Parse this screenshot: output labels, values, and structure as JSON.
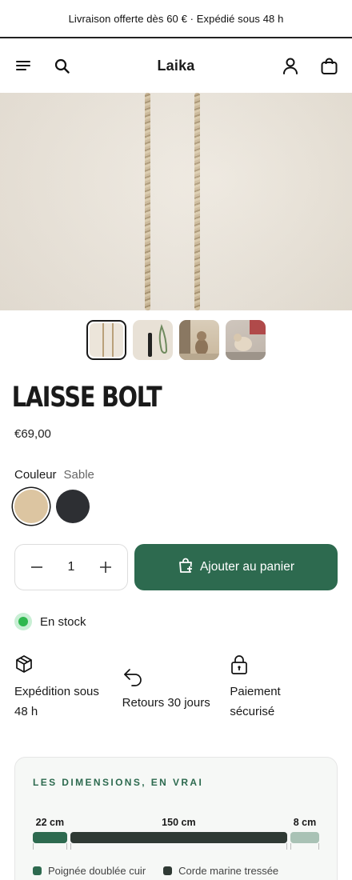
{
  "announcement": "Livraison offerte dès 60 € · Expédié sous 48 h",
  "header": {
    "brand": "Laika",
    "icons": [
      "menu-icon",
      "search-icon",
      "account-icon",
      "cart-icon"
    ]
  },
  "gallery": {
    "thumbnails": [
      "thumbnail-1",
      "thumbnail-2",
      "thumbnail-3",
      "thumbnail-4"
    ],
    "active_index": 0
  },
  "product": {
    "title": "LAISSE BOLT",
    "price": "€69,00"
  },
  "color": {
    "label": "Couleur",
    "selected": "Sable",
    "swatches": [
      {
        "name": "Sable",
        "hex": "#dcc5a1"
      },
      {
        "name": "dark",
        "hex": "#2d2f33"
      }
    ]
  },
  "quantity": {
    "value": "1",
    "minus": "−",
    "plus": "+"
  },
  "add_to_cart": "Ajouter au panier",
  "stock": "En stock",
  "features": [
    {
      "icon": "box-icon",
      "line1": "Expédition sous",
      "line2": "48 h"
    },
    {
      "icon": "return-arrow-icon",
      "line1": "Retours 30 jours",
      "line2": ""
    },
    {
      "icon": "lock-icon",
      "line1": "Paiement",
      "line2": "sécurisé"
    }
  ],
  "dimensions": {
    "heading": "LES DIMENSIONS, EN VRAI",
    "segments": [
      {
        "label": "22 cm",
        "length": 22,
        "color": "#2d6a4f"
      },
      {
        "label": "150 cm",
        "length": 150,
        "color": "#2f3a34"
      },
      {
        "label": "8 cm",
        "length": 8,
        "color": "#a9c2b5"
      }
    ],
    "legend": [
      {
        "label": "Poignée doublée cuir",
        "color": "#2d6a4f"
      },
      {
        "label": "Corde marine tressée",
        "color": "#2f3a34"
      }
    ]
  },
  "colors": {
    "accent": "#2d6a4f",
    "stock_green": "#2fb84f"
  }
}
